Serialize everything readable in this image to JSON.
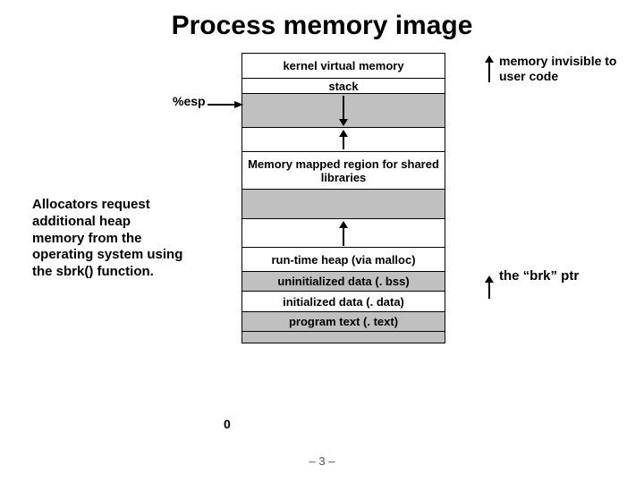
{
  "title": "Process memory image",
  "segments": {
    "kvm": "kernel virtual memory",
    "stack": "stack",
    "mmap": "Memory mapped region for shared libraries",
    "heap": "run-time heap (via malloc)",
    "bss": "uninitialized data (. bss)",
    "data": "initialized data (. data)",
    "text": "program text (. text)"
  },
  "labels": {
    "esp": "%esp",
    "zero": "0"
  },
  "notes": {
    "allocator": "Allocators request additional heap memory from the operating system using the sbrk() function.",
    "invisible": "memory invisible to user code",
    "brk": "the “brk” ptr"
  },
  "page": "– 3 –"
}
